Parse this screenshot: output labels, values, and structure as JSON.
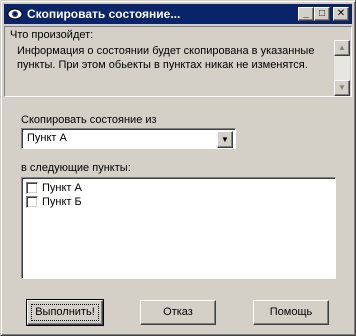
{
  "window": {
    "title": "Скопировать состояние...",
    "icon": "eye-icon",
    "controls": {
      "minimize": "_",
      "maximize": "□",
      "close": "✕"
    }
  },
  "info": {
    "heading": "Что произойдет:",
    "text": "Информация о состоянии будет скопирована в указанные пункты. При этом обьекты в пунктах никак не изменятся."
  },
  "copy_from": {
    "label": "Скопировать состояние из",
    "selected": "Пункт А"
  },
  "targets": {
    "label": "в следующие пункты:",
    "items": [
      {
        "label": "Пункт А",
        "checked": false
      },
      {
        "label": "Пункт Б",
        "checked": false
      }
    ]
  },
  "buttons": {
    "execute": "Выполнить!",
    "cancel": "Отказ",
    "help": "Помощь"
  }
}
